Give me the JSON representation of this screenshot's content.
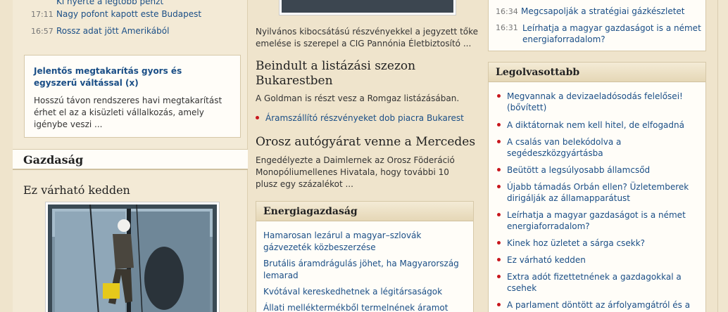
{
  "left_top_news": [
    {
      "time": "",
      "title": "Ki nyerte a legtöbb pénzt"
    },
    {
      "time": "17:11",
      "title": "Nagy pofont kapott este Budapest"
    },
    {
      "time": "16:57",
      "title": "Rossz adat jött Amerikából"
    }
  ],
  "promo": {
    "title": "Jelentős megtakarítás gyors és egyszerű váltással (x)",
    "body": "Hosszú távon rendszeres havi megtakarítást érhet el az a kisüzleti vállalkozás, amely igénybe veszi ..."
  },
  "gazdasag": {
    "heading": "Gazdaság",
    "article_title": "Ez várható kedden"
  },
  "middle": {
    "intro_text": "Nyilvános kibocsátású részvényekkel a jegyzett tőke emelése is szerepel a CIG Pannónia Életbiztosító ...",
    "article1_title": "Beindult a listázási szezon Bukarestben",
    "article1_text": "A Goldman is részt vesz a Romgaz listázásában.",
    "article1_related": "Áramszállító részvényeket dob piacra Bukarest",
    "article2_title": "Orosz autógyárat venne a Mercedes",
    "article2_text": "Engedélyezte a Daimlernek az Orosz Föderáció Monopóliumellenes Hivatala, hogy további 10 plusz egy százalékot ..."
  },
  "energia": {
    "heading": "Energiagazdaság",
    "links": [
      "Hamarosan lezárul a magyar–szlovák gázvezeték közbeszerzése",
      "Brutális áramdrágulás jöhet, ha Magyarország lemarad",
      "Kvótával kereskedhetnek a légitársaságok",
      "Állati melléktermékből termelnének áramot"
    ]
  },
  "right_top_news": [
    {
      "time": "16:34",
      "title": "Megcsapolják a stratégiai gázkészletet"
    },
    {
      "time": "16:31",
      "title": "Leírhatja a magyar gazdaságot is a német energiaforradalom?"
    }
  ],
  "legolvasottabb": {
    "heading": "Legolvasottabb",
    "items": [
      "Megvannak a devizaeladósodás felelősei! (bővített)",
      "A diktátornak nem kell hitel, de elfogadná",
      "A csalás van belekódolva a segédeszközgyártásba",
      "Beütött a legsúlyosabb államcsőd",
      "Újabb támadás Orbán ellen? Üzletemberek dirigálják az államapparátust",
      "Leírhatja a magyar gazdaságot is a német energiaforradalom?",
      "Kinek hoz üzletet a sárga csekk?",
      "Ez várható kedden",
      "Extra adót fizettetnének a gazdagokkal a csehek",
      "A parlament döntött az árfolyamgátról és a"
    ]
  }
}
